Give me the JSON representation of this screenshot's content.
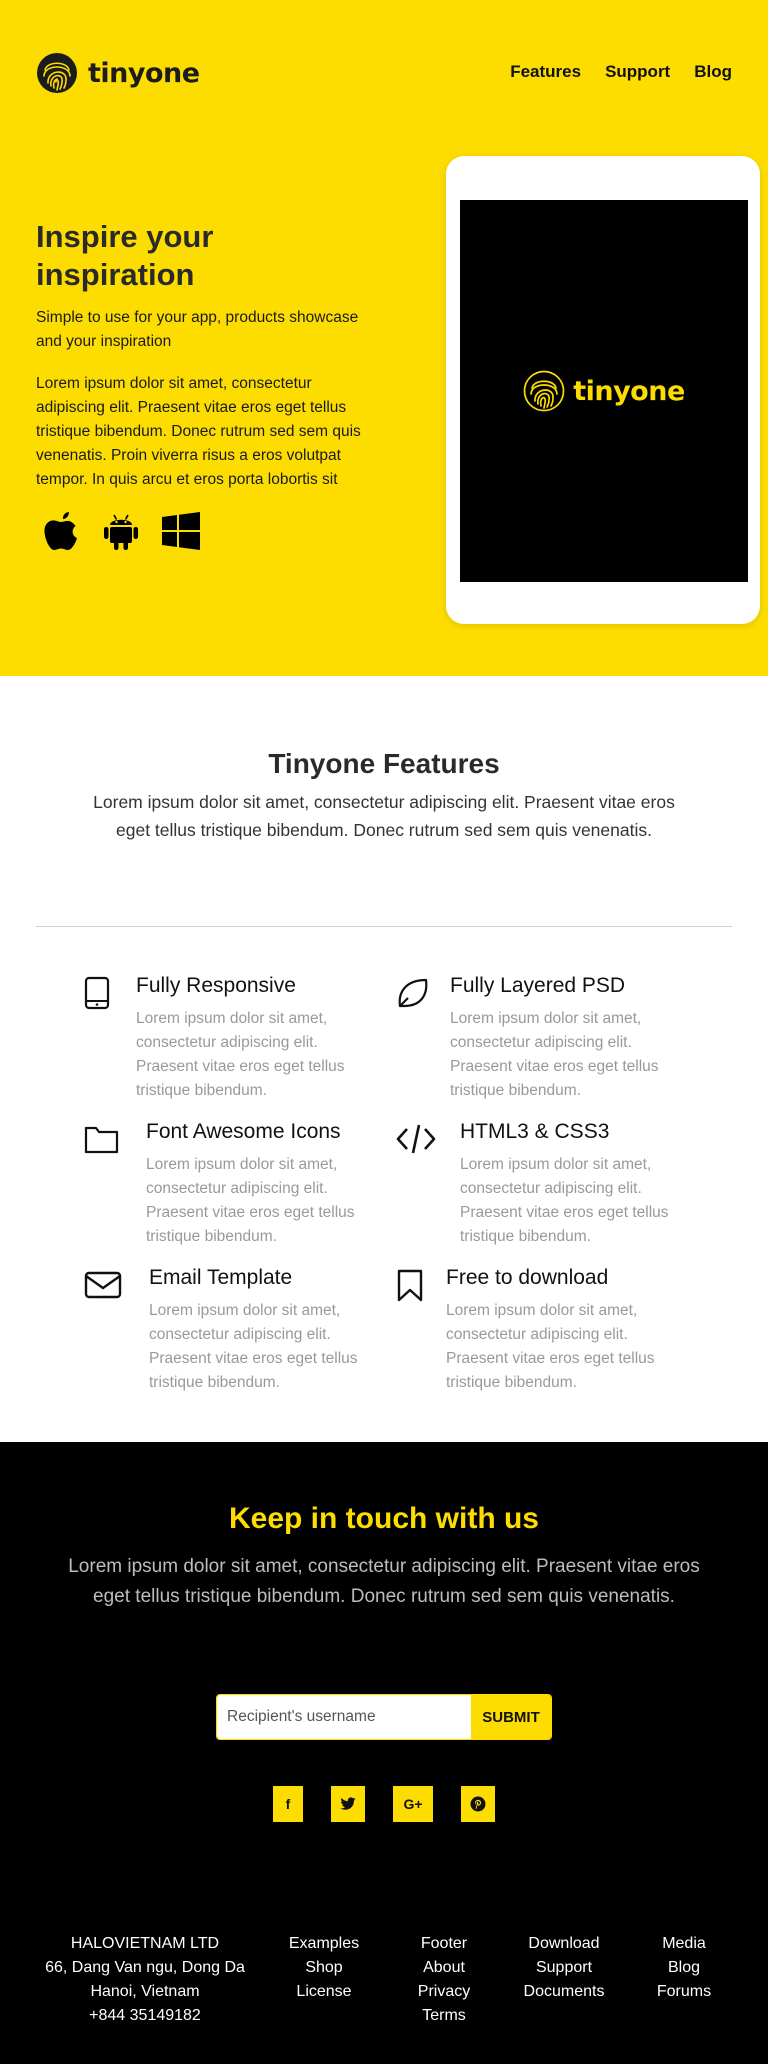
{
  "brand": {
    "name": "tinyone",
    "icon": "fingerprint-icon"
  },
  "nav": {
    "items": [
      "Features",
      "Support",
      "Blog"
    ]
  },
  "hero": {
    "title": "Inspire your inspiration",
    "subtitle": "Simple to use for your app, products showcase and your inspiration",
    "body": "Lorem ipsum dolor sit amet, consectetur adipiscing elit. Praesent vitae eros eget tellus tristique bibendum. Donec rutrum sed sem quis venenatis. Proin viverra risus a eros volutpat tempor. In quis arcu et eros porta lobortis sit",
    "platform_icons": [
      "apple-icon",
      "android-icon",
      "windows-icon"
    ],
    "device_logo": "tinyone"
  },
  "features": {
    "title": "Tinyone Features",
    "intro": "Lorem ipsum dolor sit amet, consectetur adipiscing elit. Praesent vitae eros eget tellus tristique bibendum. Donec rutrum sed sem quis venenatis.",
    "items": [
      {
        "title": "Fully Responsive",
        "icon": "tablet-icon",
        "desc": "Lorem ipsum dolor sit amet, consectetur adipiscing elit. Praesent vitae eros eget tellus tristique bibendum."
      },
      {
        "title": "Fully Layered PSD",
        "icon": "leaf-icon",
        "desc": "Lorem ipsum dolor sit amet, consectetur adipiscing elit. Praesent vitae eros eget tellus tristique bibendum."
      },
      {
        "title": "Font Awesome Icons",
        "icon": "folder-icon",
        "desc": "Lorem ipsum dolor sit amet, consectetur adipiscing elit. Praesent vitae eros eget tellus tristique bibendum."
      },
      {
        "title": "HTML3 & CSS3",
        "icon": "code-icon",
        "desc": "Lorem ipsum dolor sit amet, consectetur adipiscing elit. Praesent vitae eros eget tellus tristique bibendum."
      },
      {
        "title": "Email Template",
        "icon": "envelope-icon",
        "desc": "Lorem ipsum dolor sit amet, consectetur adipiscing elit. Praesent vitae eros eget tellus tristique bibendum."
      },
      {
        "title": "Free to download",
        "icon": "bookmark-icon",
        "desc": "Lorem ipsum dolor sit amet, consectetur adipiscing elit. Praesent vitae eros eget tellus tristique bibendum."
      }
    ]
  },
  "contact": {
    "title": "Keep in touch with us",
    "text": "Lorem ipsum dolor sit amet, consectetur adipiscing elit. Praesent vitae eros eget tellus tristique bibendum. Donec rutrum sed sem quis venenatis.",
    "placeholder": "Recipient's username",
    "submit": "SUBMIT",
    "social": [
      {
        "label": "f",
        "icon": "facebook-icon"
      },
      {
        "label": "t",
        "icon": "twitter-icon"
      },
      {
        "label": "G+",
        "icon": "google-plus-icon"
      },
      {
        "label": "p",
        "icon": "pinterest-icon"
      }
    ]
  },
  "footer": {
    "company": [
      "HALOVIETNAM LTD",
      "66, Dang Van ngu, Dong Da",
      "Hanoi, Vietnam",
      "+844 35149182"
    ],
    "col1": [
      "Examples",
      "Shop",
      "License"
    ],
    "col2": [
      "Footer",
      "About",
      "Privacy",
      "Terms"
    ],
    "col3": [
      "Download",
      "Support",
      "Documents"
    ],
    "col4": [
      "Media",
      "Blog",
      "Forums"
    ]
  },
  "colors": {
    "accent": "#FDDD00",
    "dark": "#000000",
    "text": "#2a2a2a",
    "muted": "#999999"
  }
}
